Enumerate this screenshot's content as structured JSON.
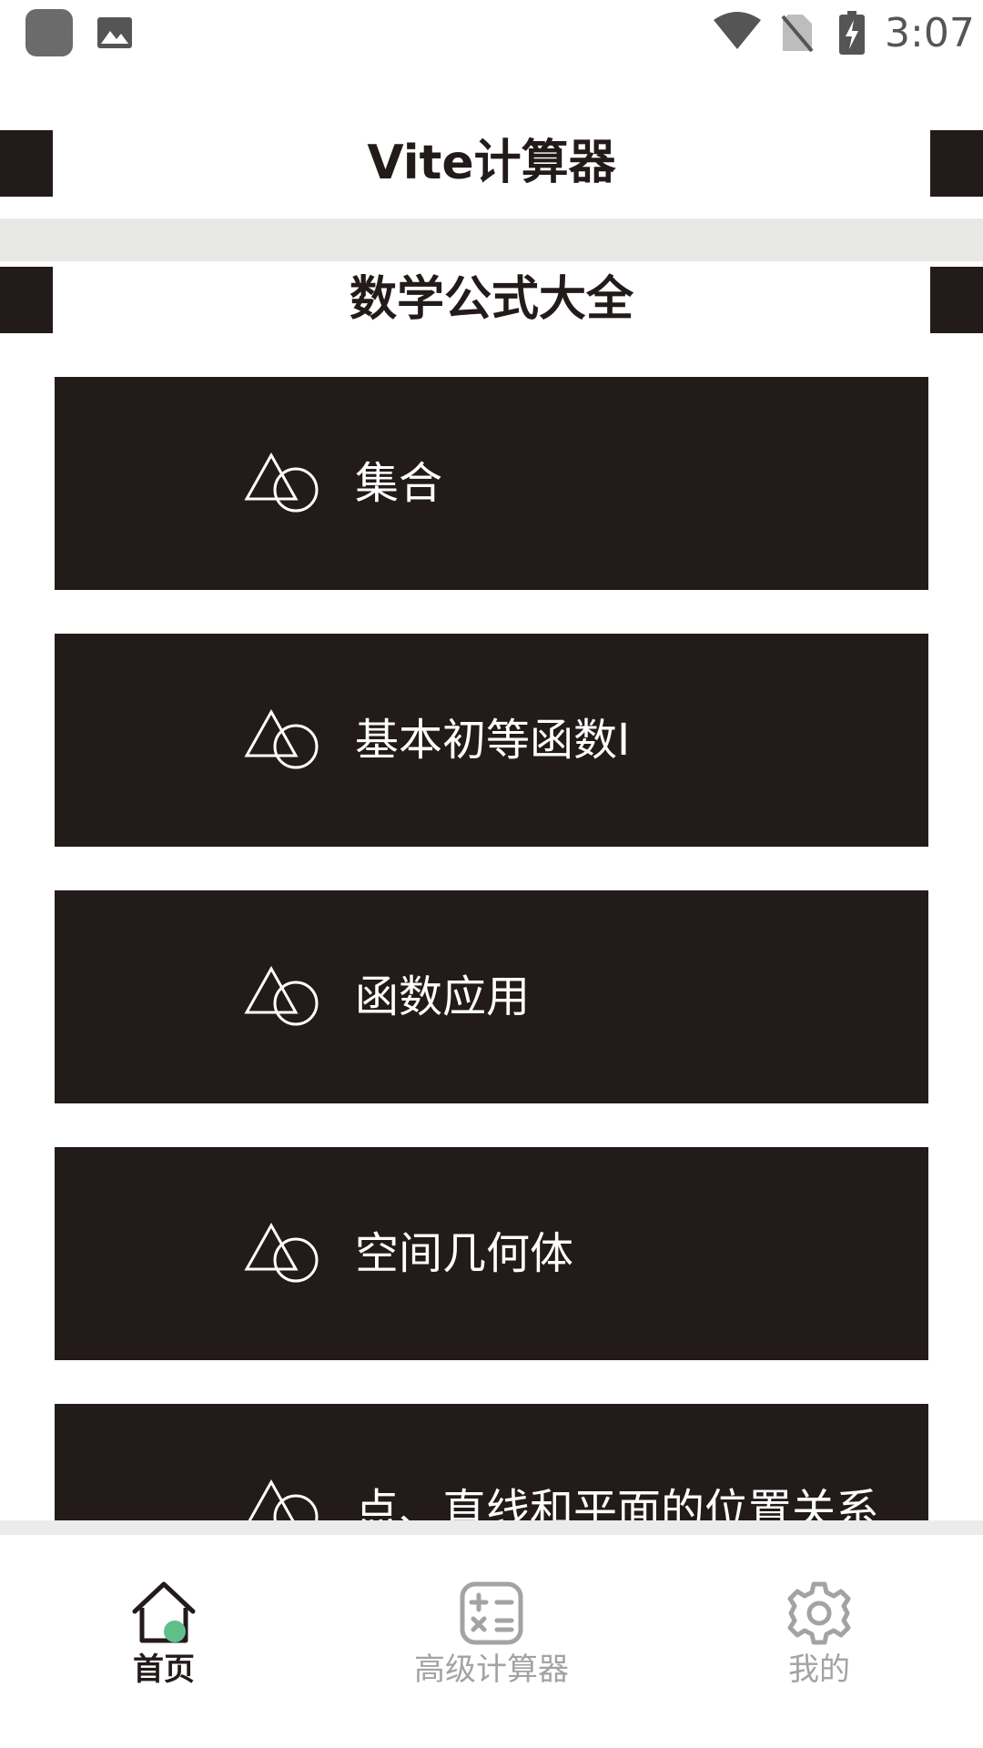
{
  "status_bar": {
    "time": "3:07",
    "icons": [
      "app-icon",
      "image-icon",
      "wifi-icon",
      "no-sim-icon",
      "battery-charging-icon"
    ]
  },
  "header": {
    "title": "Vite计算器"
  },
  "section": {
    "title": "数学公式大全"
  },
  "items": [
    {
      "label": "集合",
      "icon": "triangle-circle-icon"
    },
    {
      "label": "基本初等函数I",
      "icon": "triangle-circle-icon"
    },
    {
      "label": "函数应用",
      "icon": "triangle-circle-icon"
    },
    {
      "label": "空间几何体",
      "icon": "triangle-circle-icon"
    },
    {
      "label": "点、直线和平面的位置关系",
      "icon": "triangle-circle-icon"
    }
  ],
  "nav": {
    "home": {
      "label": "首页",
      "icon": "home-icon",
      "active": true
    },
    "calculator": {
      "label": "高级计算器",
      "icon": "calculator-icon",
      "active": false
    },
    "mine": {
      "label": "我的",
      "icon": "gear-icon",
      "active": false
    }
  },
  "colors": {
    "card_bg": "#231a1a",
    "accent_green": "#5fbf8b",
    "inactive": "#a3a3a3",
    "divider": "#e8e8e6"
  }
}
